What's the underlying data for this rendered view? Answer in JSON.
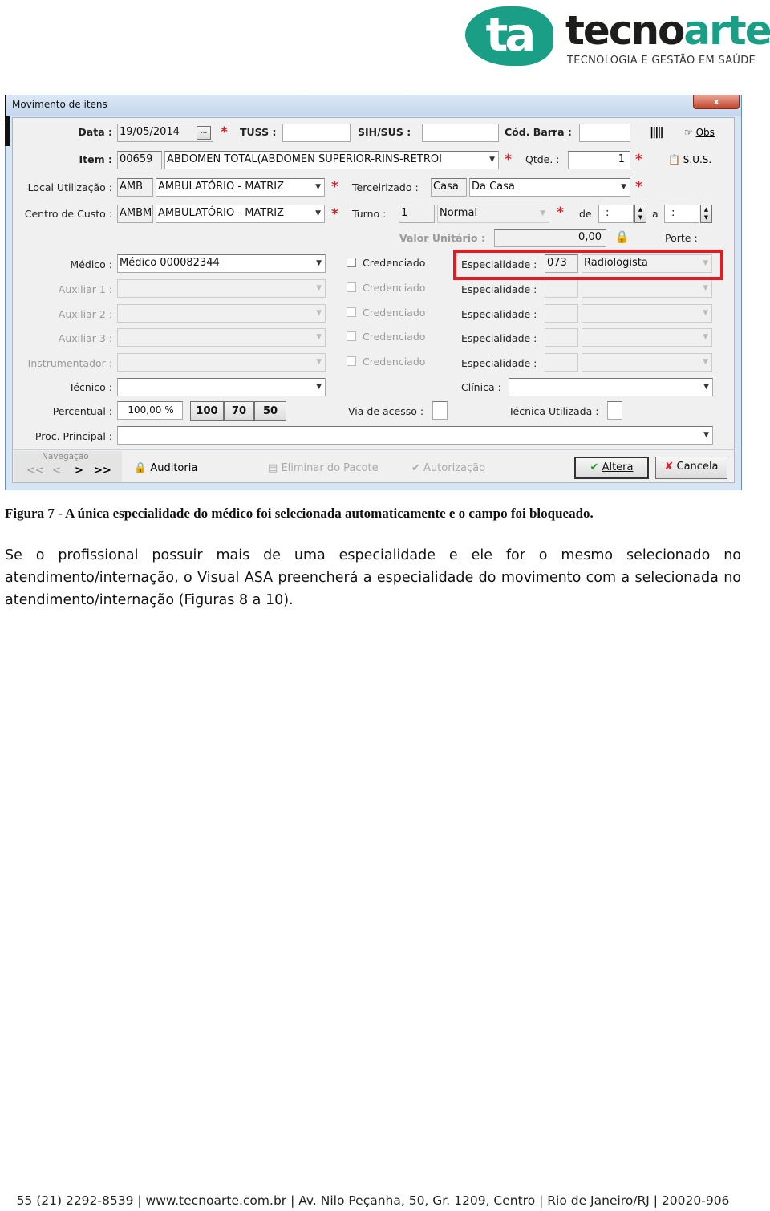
{
  "logo": {
    "mark": "ta",
    "word1": "tecno",
    "word2": "arte",
    "tagline": "TECNOLOGIA E GESTÃO EM SAÚDE"
  },
  "window": {
    "title": "Movimento de itens",
    "close": "x",
    "data_label": "Data :",
    "data_value": "19/05/2014",
    "date_btn": "...",
    "tuss_label": "TUSS :",
    "tuss_value": "",
    "sih_label": "SIH/SUS :",
    "sih_value": "",
    "barra_label": "Cód. Barra :",
    "barra_value": "",
    "obs_label": "Obs",
    "sus_label": "S.U.S.",
    "item_label": "Item :",
    "item_code": "00659",
    "item_desc": "ABDOMEN TOTAL(ABDOMEN SUPERIOR-RINS-RETROI",
    "qtde_label": "Qtde. :",
    "qtde_value": "1",
    "local_label": "Local Utilização :",
    "local_code": "AMB",
    "local_desc": "AMBULATÓRIO - MATRIZ",
    "terc_label": "Terceirizado :",
    "terc_code": "Casa",
    "terc_desc": "Da Casa",
    "centro_label": "Centro de Custo :",
    "centro_code": "AMBM",
    "centro_desc": "AMBULATÓRIO - MATRIZ",
    "turno_label": "Turno :",
    "turno_code": "1",
    "turno_desc": "Normal",
    "de_label": "de",
    "de_value": ":",
    "a_label": "a",
    "a_value": ":",
    "valor_label": "Valor Unitário :",
    "valor_value": "0,00",
    "porte_label": "Porte :",
    "credenciado": "Credenciado",
    "especialidade": "Especialidade :",
    "rows": [
      {
        "label": "Médico :",
        "value": "Médico 000082344",
        "esp_code": "073",
        "esp_desc": "Radiologista",
        "enabled": true
      },
      {
        "label": "Auxiliar 1 :",
        "value": "",
        "esp_code": "",
        "esp_desc": "",
        "enabled": false
      },
      {
        "label": "Auxiliar 2 :",
        "value": "",
        "esp_code": "",
        "esp_desc": "",
        "enabled": false
      },
      {
        "label": "Auxiliar 3 :",
        "value": "",
        "esp_code": "",
        "esp_desc": "",
        "enabled": false
      },
      {
        "label": "Instrumentador :",
        "value": "",
        "esp_code": "",
        "esp_desc": "",
        "enabled": false
      }
    ],
    "tecnico_label": "Técnico :",
    "clinica_label": "Clínica :",
    "percentual_label": "Percentual :",
    "percentual_value": "100,00 %",
    "pct_buttons": [
      "100",
      "70",
      "50"
    ],
    "via_label": "Via de acesso :",
    "tecnica_label": "Técnica Utilizada :",
    "proc_label": "Proc. Principal :",
    "nav_label": "Navegação",
    "nav": [
      "<<",
      "<",
      ">",
      ">>"
    ],
    "auditoria": "Auditoria",
    "eliminar": "Eliminar do Pacote",
    "autorizacao": "Autorização",
    "altera": "Altera",
    "cancela": "Cancela"
  },
  "caption": "Figura 7 - A única especialidade do médico foi selecionada automaticamente e o campo foi bloqueado.",
  "paragraph": "Se o profissional possuir mais de uma especialidade e ele for o mesmo selecionado no atendimento/internação, o Visual ASA preencherá a especialidade do movimento com a selecionada no atendimento/internação (Figuras 8 a 10).",
  "footer": "55 (21) 2292-8539 | www.tecnoarte.com.br | Av. Nilo Peçanha, 50, Gr. 1209, Centro | Rio de Janeiro/RJ | 20020-906",
  "colors": {
    "brand": "#1a9e86",
    "highlight": "#e11b22",
    "required": "#d2232a"
  }
}
